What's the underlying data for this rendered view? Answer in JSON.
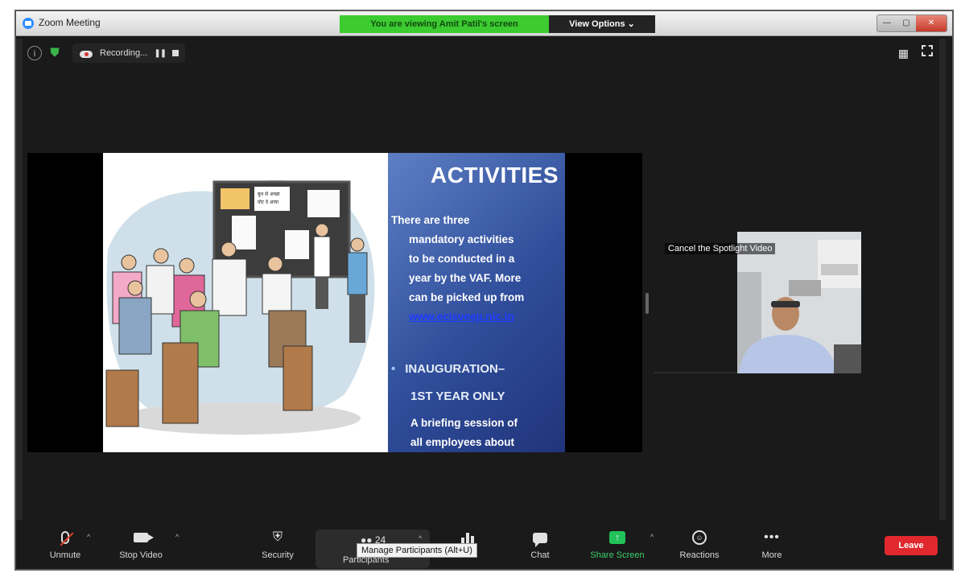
{
  "window": {
    "title": "Zoom Meeting",
    "controls": [
      "—",
      "▢",
      "✕"
    ]
  },
  "banner": {
    "viewing": "You are viewing Amit Patil's screen",
    "view_options": "View Options ⌄"
  },
  "recording": {
    "label": "Recording..."
  },
  "slide": {
    "title": "ACTIVITIES",
    "body_lines": [
      "There are three",
      "mandatory activities",
      "to be conducted in a",
      "year by the VAF. More",
      "can be picked up from"
    ],
    "link": "www.ecisveep.nic.in",
    "bullet_1": "INAUGURATION–",
    "bullet_2": "1ST YEAR ONLY",
    "sub_lines": [
      "A briefing session of",
      "all employees about"
    ],
    "illustration_sign_text": "बूथ से अच्छा\nवोट दे आया"
  },
  "speaker": {
    "spotlight_label": "Cancel the Spotlight Video"
  },
  "toolbar": {
    "unmute": "Unmute",
    "stop_video": "Stop Video",
    "security": "Security",
    "participants_count": "24",
    "participants": "Participants",
    "polls": "Polls",
    "chat": "Chat",
    "share_screen": "Share Screen",
    "reactions": "Reactions",
    "more": "More",
    "leave": "Leave",
    "tooltip": "Manage Participants (Alt+U)"
  },
  "colors": {
    "accent_green": "#3ccb30",
    "leave_red": "#e0282e",
    "slide_blue": "#2f4d9a",
    "link_blue": "#1f3bff"
  }
}
